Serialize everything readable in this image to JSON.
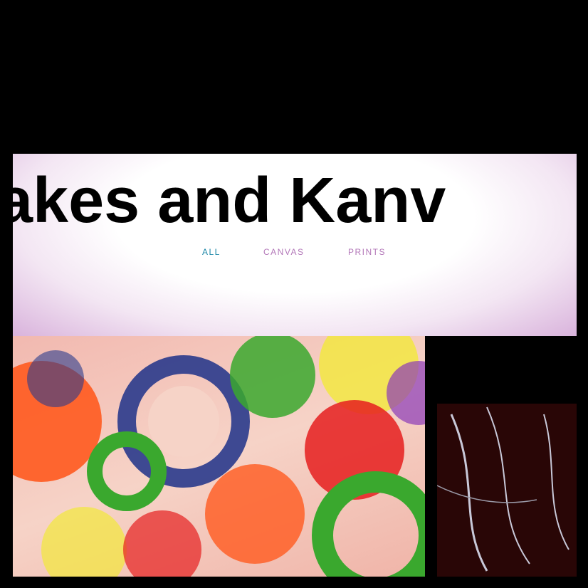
{
  "site": {
    "title": "akes and Kanv"
  },
  "nav": {
    "items": [
      {
        "label": "ALL",
        "active": true
      },
      {
        "label": "CANVAS",
        "active": false
      },
      {
        "label": "PRINTS",
        "active": false
      }
    ]
  },
  "gallery": {
    "tiles": [
      {
        "kind": "painting",
        "palette": [
          "#ff5a1f",
          "#2a3a8c",
          "#3aa82e",
          "#f2e83a",
          "#e51f1f",
          "#8b3ab8"
        ]
      },
      {
        "kind": "painting",
        "palette": [
          "#000000",
          "#5a1010",
          "#c8c8d8"
        ]
      }
    ]
  },
  "colors": {
    "nav_active": "#1e88a8",
    "nav_inactive": "#b378b9",
    "title_text": "#000000",
    "page_bg": "#000000"
  }
}
